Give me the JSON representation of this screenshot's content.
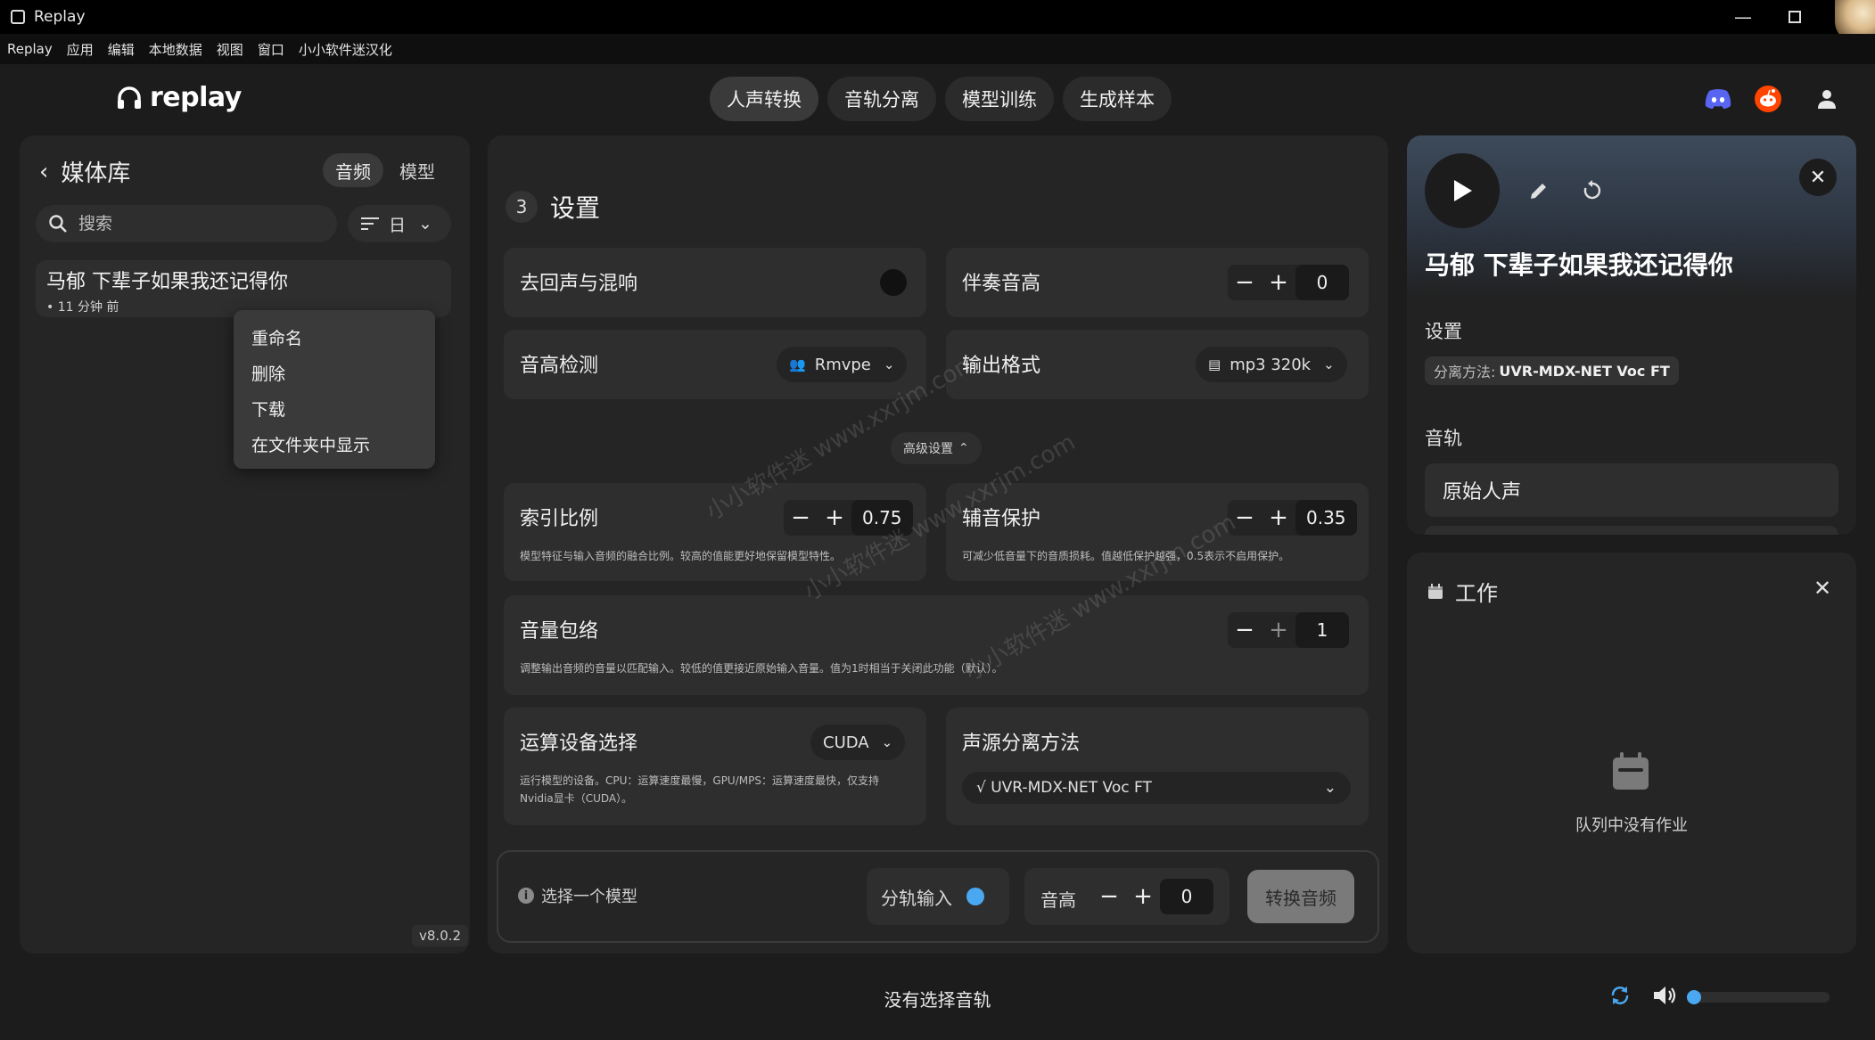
{
  "window": {
    "title": "Replay"
  },
  "menu": [
    "Replay",
    "应用",
    "编辑",
    "本地数据",
    "视图",
    "窗口",
    "小小软件迷汉化"
  ],
  "header": {
    "logo_text": "replay",
    "tabs": [
      "人声转换",
      "音轨分离",
      "模型训练",
      "生成样本"
    ],
    "active_tab": "人声转换"
  },
  "library": {
    "title": "媒体库",
    "tabs": [
      "音频",
      "模型"
    ],
    "search_placeholder": "搜索",
    "sort_label": "日",
    "item": {
      "title": "马郁 下辈子如果我还记得你",
      "subtitle": "• 11 分钟 前"
    },
    "context_menu": [
      "重命名",
      "删除",
      "下载",
      "在文件夹中显示"
    ],
    "version": "v8.0.2"
  },
  "settings": {
    "step": "3",
    "title": "设置",
    "deecho": {
      "label": "去回声与混响"
    },
    "accomp_pitch": {
      "label": "伴奏音高",
      "value": "0"
    },
    "pitch_detect": {
      "label": "音高检测",
      "value": "Rmvpe"
    },
    "output_format": {
      "label": "输出格式",
      "value": "mp3 320k"
    },
    "advanced": "高级设置",
    "index_ratio": {
      "label": "索引比例",
      "value": "0.75",
      "desc": "模型特征与输入音频的融合比例。较高的值能更好地保留模型特性。"
    },
    "consonant": {
      "label": "辅音保护",
      "value": "0.35",
      "desc": "可减少低音量下的音质损耗。值越低保护越强，0.5表示不启用保护。"
    },
    "envelope": {
      "label": "音量包络",
      "value": "1",
      "desc": "调整输出音频的音量以匹配输入。较低的值更接近原始输入音量。值为1时相当于关闭此功能（默认）。"
    },
    "device": {
      "label": "运算设备选择",
      "value": "CUDA",
      "desc1": "运行模型的设备。CPU：运算速度最慢，GPU/MPS：运算速度最快，仅支持",
      "desc2": "Nvidia显卡（CUDA）。"
    },
    "separation": {
      "label": "声源分离方法",
      "value": "√ UVR-MDX-NET Voc FT"
    }
  },
  "bottom": {
    "select_model": "选择一个模型",
    "split_input": "分轨输入",
    "pitch_label": "音高",
    "pitch_value": "0",
    "convert": "转换音频"
  },
  "player": {
    "track_title": "马郁 下辈子如果我还记得你",
    "settings_label": "设置",
    "sep_method_prefix": "分离方法:",
    "sep_method": "UVR-MDX-NET Voc FT",
    "tracks_label": "音轨",
    "track_name": "原始人声"
  },
  "jobs": {
    "title": "工作",
    "empty": "队列中没有作业"
  },
  "footer": {
    "no_track": "没有选择音轨",
    "volume_fraction": 0.0
  },
  "watermark": "小小软件迷 www.xxrjm.com",
  "colors": {
    "accent": "#4aa8f0",
    "discord": "#5865f2",
    "reddit": "#ff4500"
  }
}
